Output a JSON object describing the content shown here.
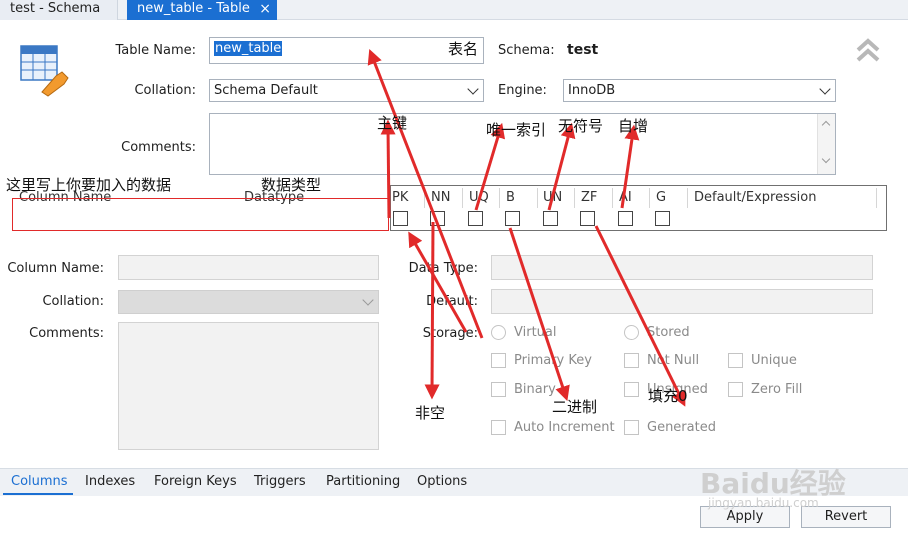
{
  "tabs": [
    {
      "label": "test - Schema"
    },
    {
      "label": "new_table - Table"
    }
  ],
  "form": {
    "table_name_label": "Table Name:",
    "table_name_value": "new_table",
    "schema_label": "Schema:",
    "schema_value": "test",
    "collation_label": "Collation:",
    "collation_value": "Schema Default",
    "engine_label": "Engine:",
    "engine_value": "InnoDB",
    "comments_label": "Comments:"
  },
  "grid": {
    "columns": [
      "Column Name",
      "Datatype",
      "PK",
      "NN",
      "UQ",
      "B",
      "UN",
      "ZF",
      "AI",
      "G",
      "Default/Expression"
    ]
  },
  "detail": {
    "column_name_label": "Column Name:",
    "collation_label": "Collation:",
    "comments_label": "Comments:",
    "data_type_label": "Data Type:",
    "default_label": "Default:",
    "storage_label": "Storage:",
    "virtual": "Virtual",
    "stored": "Stored",
    "primary_key": "Primary Key",
    "not_null": "Not Null",
    "unique": "Unique",
    "binary": "Binary",
    "unsigned": "Unsigned",
    "zero_fill": "Zero Fill",
    "auto_increment": "Auto Increment",
    "generated": "Generated"
  },
  "annotations": {
    "table_name": "表名",
    "column_name": "这里写上你要加入的数据",
    "datatype": "数据类型",
    "pk": "主键",
    "nn": "非空",
    "uq": "唯一索引",
    "b": "二进制",
    "un": "无符号",
    "zf": "填充0",
    "ai": "自增"
  },
  "bottom_tabs": [
    "Columns",
    "Indexes",
    "Foreign Keys",
    "Triggers",
    "Partitioning",
    "Options"
  ],
  "buttons": {
    "apply": "Apply",
    "revert": "Revert"
  },
  "watermark": {
    "brand": "Baidu经验",
    "url": "jingyan.baidu.com"
  },
  "colors": {
    "accent": "#1b6fd2",
    "annotation": "#e12a2a"
  }
}
